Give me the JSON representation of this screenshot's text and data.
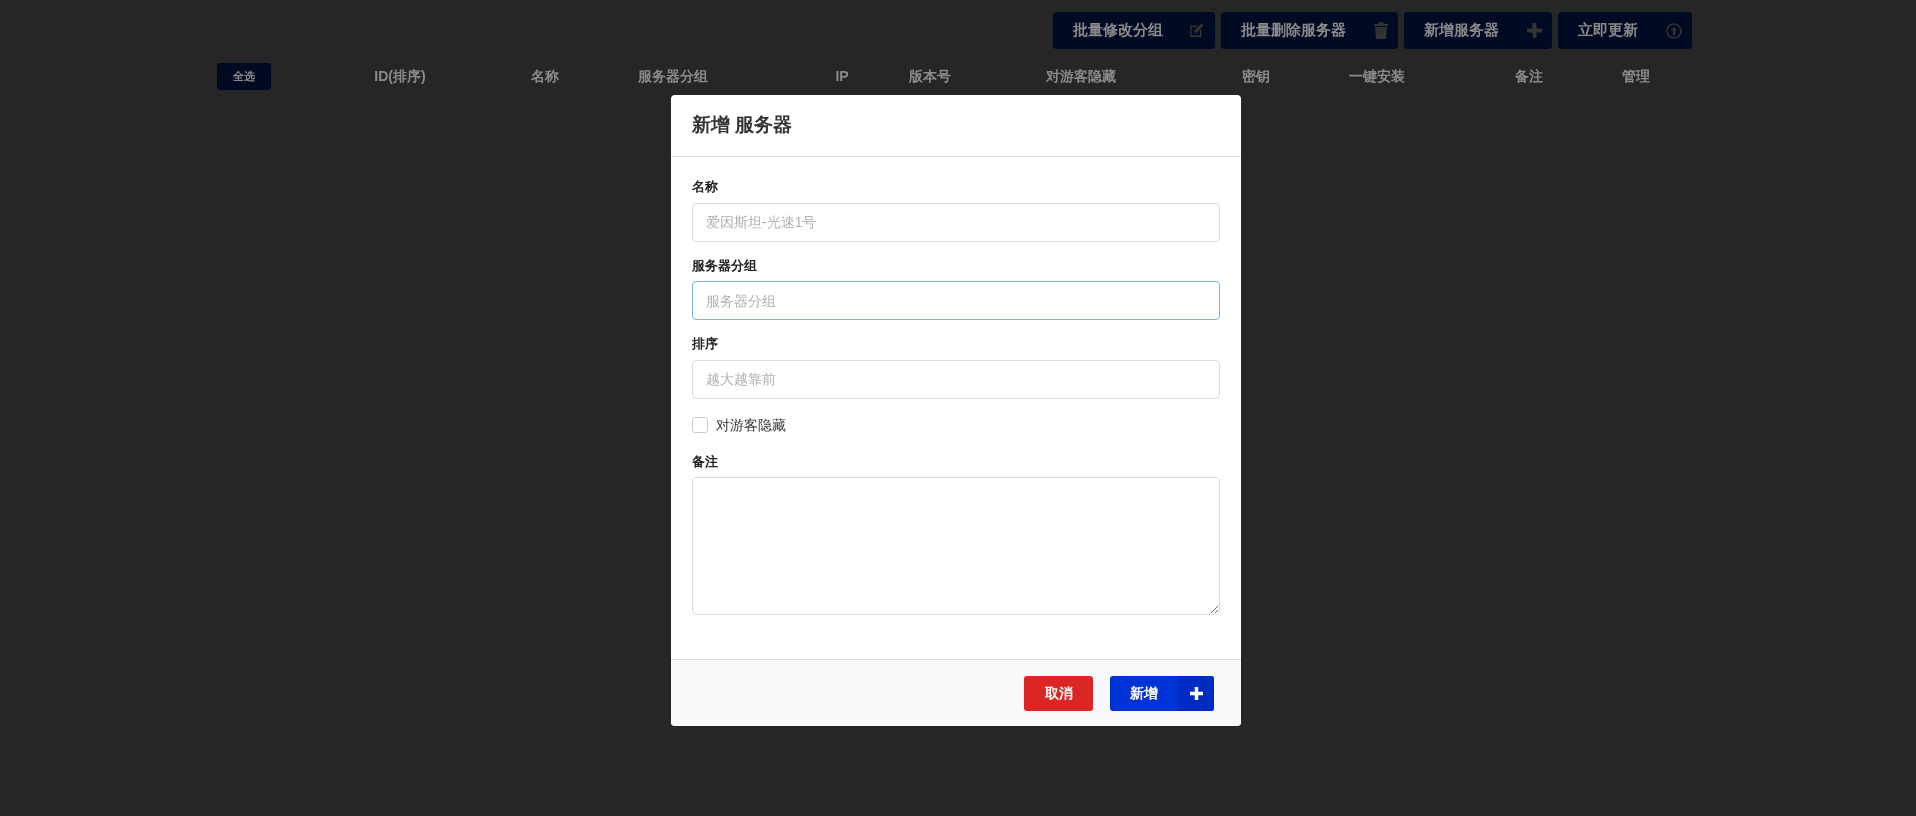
{
  "toolbar_buttons": [
    {
      "label": "批量修改分组"
    },
    {
      "label": "批量删除服务器"
    },
    {
      "label": "新增服务器"
    },
    {
      "label": "立即更新"
    }
  ],
  "table": {
    "select_all": "全选",
    "columns": [
      "ID(排序)",
      "名称",
      "服务器分组",
      "IP",
      "版本号",
      "对游客隐藏",
      "密钥",
      "一键安装",
      "备注",
      "管理"
    ]
  },
  "dialog": {
    "title": "新增 服务器",
    "fields": [
      {
        "kind": "input",
        "label": "名称",
        "placeholder": "爱因斯坦-光速1号",
        "focused": false
      },
      {
        "kind": "input",
        "label": "服务器分组",
        "placeholder": "服务器分组",
        "focused": true
      },
      {
        "kind": "input",
        "label": "排序",
        "placeholder": "越大越靠前",
        "focused": false
      },
      {
        "kind": "checkbox",
        "label": "对游客隐藏",
        "checked": false
      },
      {
        "kind": "textarea",
        "label": "备注"
      }
    ],
    "cancel_button": "取消",
    "submit_button": "新增"
  }
}
